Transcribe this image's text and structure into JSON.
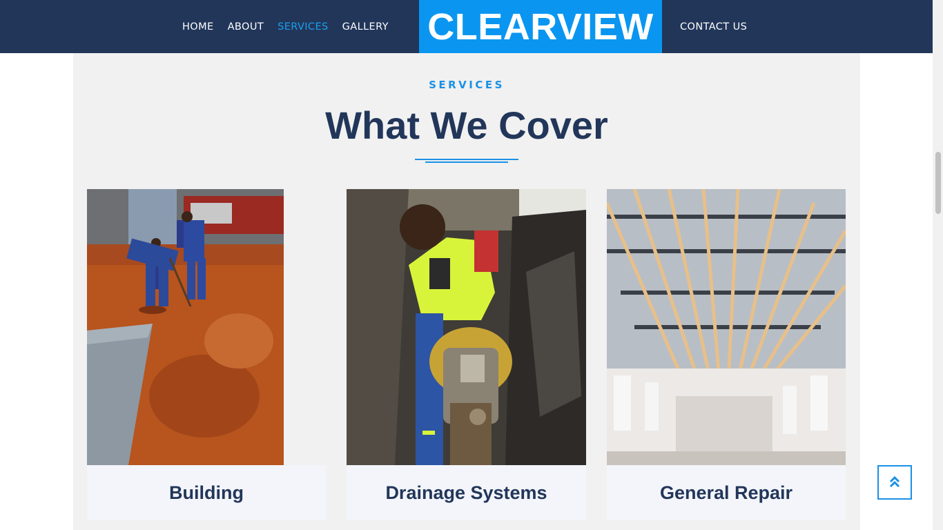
{
  "header": {
    "nav_left": [
      {
        "label": "HOME",
        "active": false
      },
      {
        "label": "ABOUT",
        "active": false
      },
      {
        "label": "SERVICES",
        "active": true
      },
      {
        "label": "GALLERY",
        "active": false
      }
    ],
    "logo": "CLEARVIEW",
    "nav_right": [
      {
        "label": "CONTACT US"
      }
    ]
  },
  "section": {
    "eyebrow": "SERVICES",
    "heading": "What We Cover"
  },
  "cards": [
    {
      "title": "Building",
      "photo": "building-site-photo"
    },
    {
      "title": "Drainage Systems",
      "photo": "drainage-trench-photo"
    },
    {
      "title": "General Repair",
      "photo": "roof-repair-photo"
    }
  ],
  "back_to_top": {
    "icon": "double-chevron-up-icon"
  },
  "colors": {
    "navy": "#22365a",
    "brand_blue": "#0a96f0",
    "accent_blue": "#1a90e6",
    "section_bg": "#f1f1f1",
    "caption_bg": "#f3f5fa"
  }
}
